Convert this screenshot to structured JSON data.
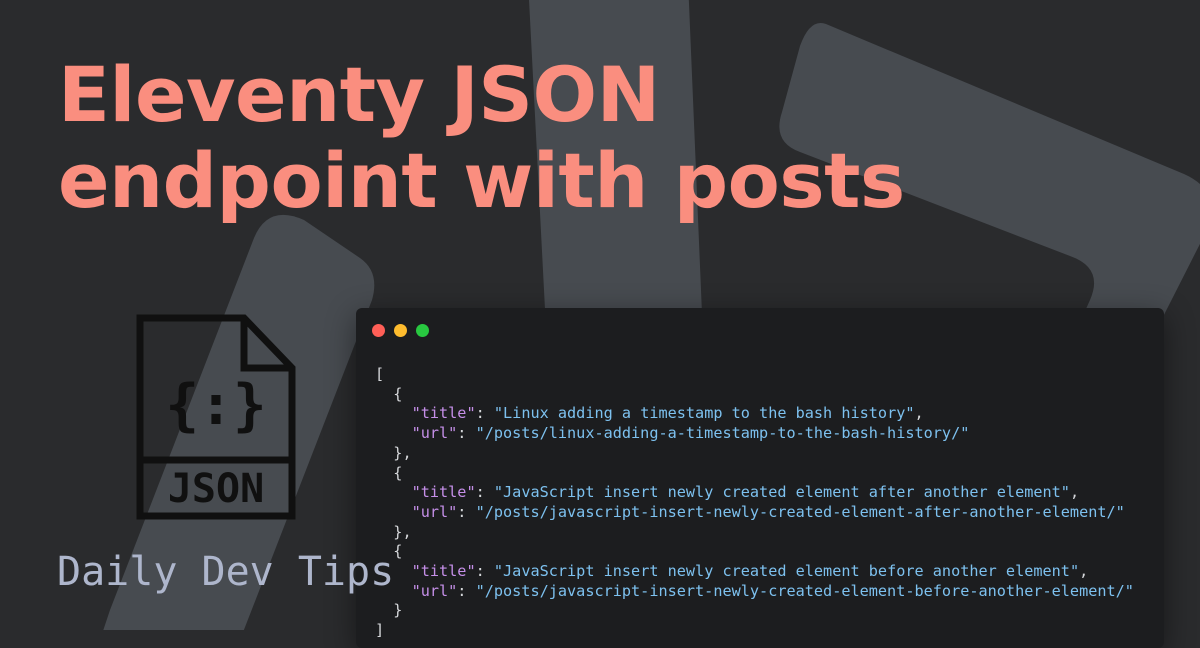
{
  "colors": {
    "background": "#2a2b2d",
    "shapes": "#474b50",
    "title": "#fa8e7f",
    "brand": "#aeb6cc",
    "json_key": "#c58fe8",
    "json_string": "#7dc1ef",
    "punctuation": "#d6d8db"
  },
  "title": {
    "line1": "Eleventy JSON",
    "line2": "endpoint with posts"
  },
  "icon": {
    "name": "json-file-icon",
    "glyph": "{:}",
    "label": "JSON"
  },
  "brand": "Daily Dev Tips",
  "window": {
    "buttons": [
      "close",
      "minimize",
      "maximize"
    ],
    "button_colors": [
      "#ff5f57",
      "#febc2e",
      "#28c840"
    ]
  },
  "code": {
    "open": "[",
    "close": "]",
    "posts": [
      {
        "title_key": "\"title\"",
        "title": "\"Linux adding a timestamp to the bash history\"",
        "url_key": "\"url\"",
        "url": "\"/posts/linux-adding-a-timestamp-to-the-bash-history/\""
      },
      {
        "title_key": "\"title\"",
        "title": "\"JavaScript insert newly created element after another element\"",
        "url_key": "\"url\"",
        "url": "\"/posts/javascript-insert-newly-created-element-after-another-element/\""
      },
      {
        "title_key": "\"title\"",
        "title": "\"JavaScript insert newly created element before another element\"",
        "url_key": "\"url\"",
        "url": "\"/posts/javascript-insert-newly-created-element-before-another-element/\""
      }
    ]
  }
}
